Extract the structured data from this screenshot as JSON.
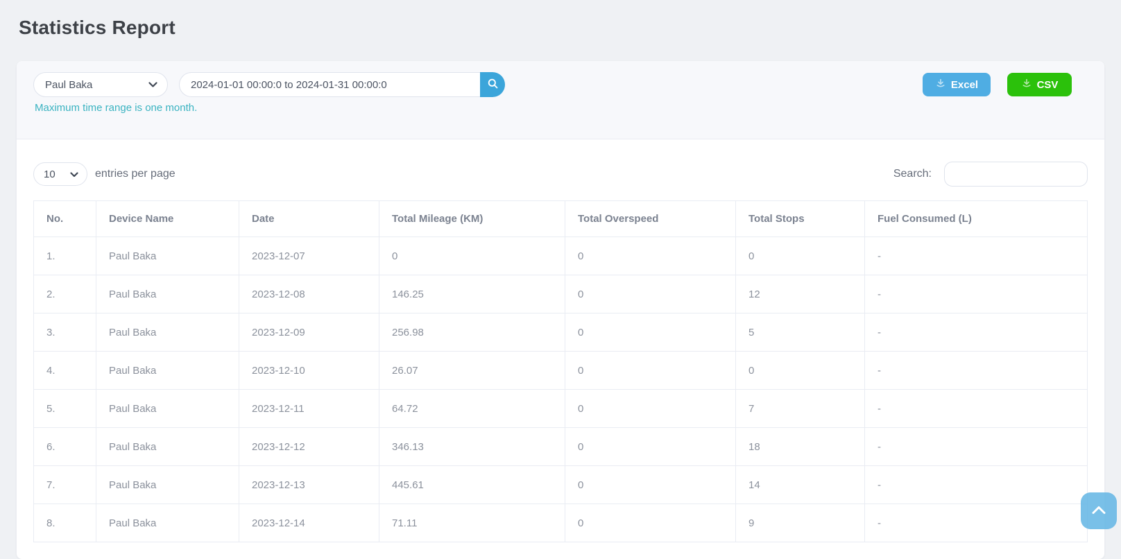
{
  "page": {
    "title": "Statistics Report"
  },
  "filter": {
    "device_select_value": "Paul Baka",
    "date_range_value": "2024-01-01 00:00:0 to 2024-01-31 00:00:0",
    "helper_text": "Maximum time range is one month.",
    "excel_button_label": "Excel",
    "csv_button_label": "CSV"
  },
  "table_controls": {
    "page_size_value": "10",
    "entries_label": "entries per page",
    "search_label": "Search:",
    "search_value": ""
  },
  "table": {
    "columns": [
      "No.",
      "Device Name",
      "Date",
      "Total Mileage (KM)",
      "Total Overspeed",
      "Total Stops",
      "Fuel Consumed (L)"
    ],
    "rows": [
      [
        "1.",
        "Paul Baka",
        "2023-12-07",
        "0",
        "0",
        "0",
        "-"
      ],
      [
        "2.",
        "Paul Baka",
        "2023-12-08",
        "146.25",
        "0",
        "12",
        "-"
      ],
      [
        "3.",
        "Paul Baka",
        "2023-12-09",
        "256.98",
        "0",
        "5",
        "-"
      ],
      [
        "4.",
        "Paul Baka",
        "2023-12-10",
        "26.07",
        "0",
        "0",
        "-"
      ],
      [
        "5.",
        "Paul Baka",
        "2023-12-11",
        "64.72",
        "0",
        "7",
        "-"
      ],
      [
        "6.",
        "Paul Baka",
        "2023-12-12",
        "346.13",
        "0",
        "18",
        "-"
      ],
      [
        "7.",
        "Paul Baka",
        "2023-12-13",
        "445.61",
        "0",
        "14",
        "-"
      ],
      [
        "8.",
        "Paul Baka",
        "2023-12-14",
        "71.11",
        "0",
        "9",
        "-"
      ]
    ]
  },
  "icons": {
    "device_select_caret": "chevron-down",
    "page_size_caret": "chevron-down",
    "search_button_icon": "magnifier",
    "excel_button_icon": "download",
    "csv_button_icon": "download",
    "scroll_top_icon": "chevron-up"
  },
  "colors": {
    "search_button_blue": "#3ba5da",
    "excel_blue": "#4fade3",
    "csv_green": "#2bc10b",
    "helper_teal": "#3ab3c1",
    "scroll_top_blue": "#62b5e4",
    "page_background": "#eff1f4"
  }
}
